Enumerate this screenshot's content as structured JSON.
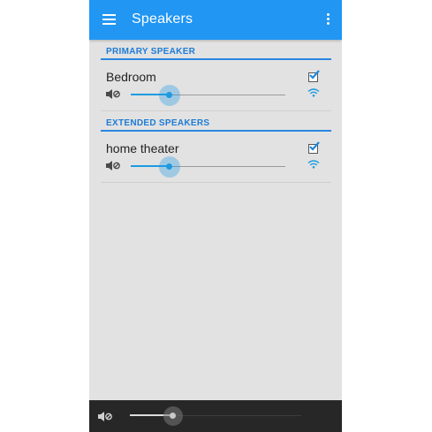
{
  "app_bar": {
    "title": "Speakers",
    "menu_icon": "hamburger-menu-icon",
    "overflow_icon": "more-vert-icon",
    "color": "#2196f3"
  },
  "sections": [
    {
      "header": "PRIMARY SPEAKER",
      "speakers": [
        {
          "name": "Bedroom",
          "checked": true,
          "volume": 0.25,
          "mute_icon": "speaker-mute-icon",
          "signal_icon": "wifi-signal-icon"
        }
      ]
    },
    {
      "header": "EXTENDED SPEAKERS",
      "speakers": [
        {
          "name": "home theater",
          "checked": true,
          "volume": 0.25,
          "mute_icon": "speaker-mute-icon",
          "signal_icon": "wifi-signal-icon"
        }
      ]
    }
  ],
  "master_volume": {
    "value": 0.25,
    "icon": "speaker-mute-icon"
  },
  "colors": {
    "accent": "#1e9be0",
    "header_text": "#1e7bd6",
    "background": "#e2e2e2",
    "bottom_bar": "#272727"
  }
}
